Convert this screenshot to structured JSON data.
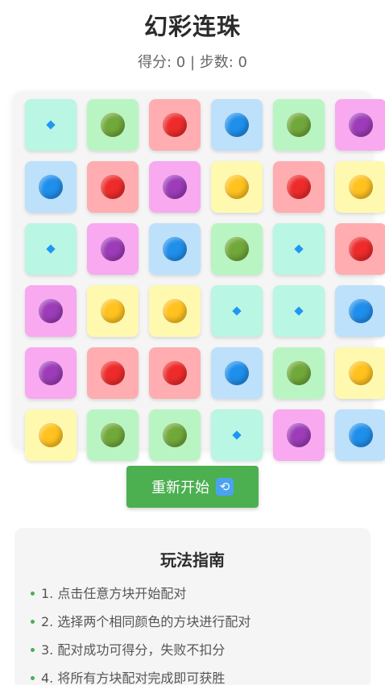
{
  "app": {
    "title": "幻彩连珠"
  },
  "stats": {
    "score_text": "得分: 0 | 步数: 0",
    "score": 0,
    "steps": 0
  },
  "colors": {
    "tile_bg": {
      "mint": "#b9f6e4",
      "green": "#b9f5c3",
      "red": "#ffadb0",
      "blue": "#bde0fb",
      "purple": "#f8a9f0",
      "yellow": "#fff9b0"
    },
    "ball": {
      "green": "#71a83a",
      "red": "#ee2b2b",
      "blue": "#1f8fec",
      "purple": "#9d3cb8",
      "yellow": "#ffc21f"
    },
    "accent_button": "#4caf50"
  },
  "board": {
    "rows": [
      [
        {
          "tile": "mint",
          "ball": "diamond"
        },
        {
          "tile": "green",
          "ball": "green"
        },
        {
          "tile": "red",
          "ball": "red"
        },
        {
          "tile": "blue",
          "ball": "blue"
        },
        {
          "tile": "green",
          "ball": "green"
        },
        {
          "tile": "purple",
          "ball": "purple"
        }
      ],
      [
        {
          "tile": "blue",
          "ball": "blue"
        },
        {
          "tile": "red",
          "ball": "red"
        },
        {
          "tile": "purple",
          "ball": "purple"
        },
        {
          "tile": "yellow",
          "ball": "yellow"
        },
        {
          "tile": "red",
          "ball": "red"
        },
        {
          "tile": "yellow",
          "ball": "yellow"
        }
      ],
      [
        {
          "tile": "mint",
          "ball": "diamond"
        },
        {
          "tile": "purple",
          "ball": "purple"
        },
        {
          "tile": "blue",
          "ball": "blue"
        },
        {
          "tile": "green",
          "ball": "green"
        },
        {
          "tile": "mint",
          "ball": "diamond"
        },
        {
          "tile": "red",
          "ball": "red"
        }
      ],
      [
        {
          "tile": "purple",
          "ball": "purple"
        },
        {
          "tile": "yellow",
          "ball": "yellow"
        },
        {
          "tile": "yellow",
          "ball": "yellow"
        },
        {
          "tile": "mint",
          "ball": "diamond"
        },
        {
          "tile": "mint",
          "ball": "diamond"
        },
        {
          "tile": "blue",
          "ball": "blue"
        }
      ],
      [
        {
          "tile": "purple",
          "ball": "purple"
        },
        {
          "tile": "red",
          "ball": "red"
        },
        {
          "tile": "red",
          "ball": "red"
        },
        {
          "tile": "blue",
          "ball": "blue"
        },
        {
          "tile": "green",
          "ball": "green"
        },
        {
          "tile": "yellow",
          "ball": "yellow"
        }
      ],
      [
        {
          "tile": "yellow",
          "ball": "yellow"
        },
        {
          "tile": "green",
          "ball": "green"
        },
        {
          "tile": "green",
          "ball": "green"
        },
        {
          "tile": "mint",
          "ball": "diamond"
        },
        {
          "tile": "purple",
          "ball": "purple"
        },
        {
          "tile": "blue",
          "ball": "blue"
        }
      ]
    ]
  },
  "restart_button": {
    "label": "重新开始",
    "icon": "refresh-icon",
    "icon_glyph": "⟲"
  },
  "guide": {
    "title": "玩法指南",
    "items": [
      "1. 点击任意方块开始配对",
      "2. 选择两个相同颜色的方块进行配对",
      "3. 配对成功可得分，失败不扣分",
      "4. 将所有方块配对完成即可获胜"
    ]
  }
}
